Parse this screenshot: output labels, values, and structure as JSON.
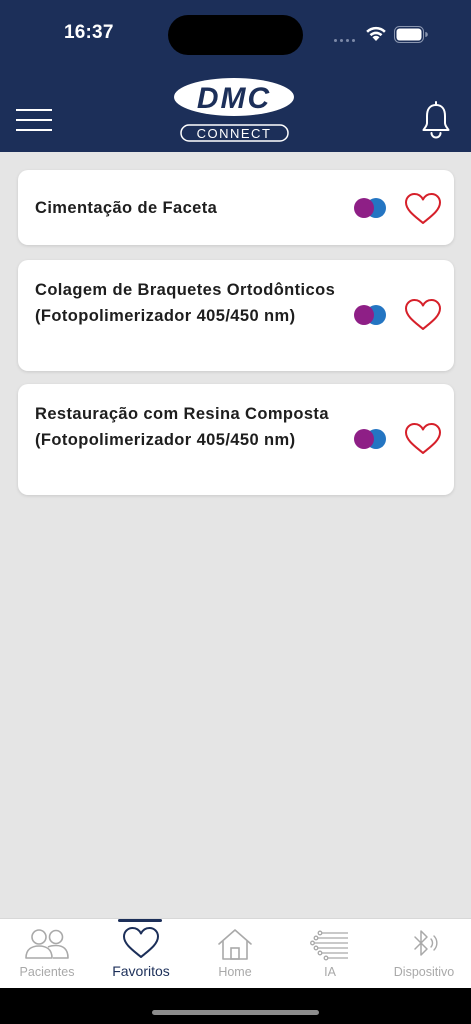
{
  "status_bar": {
    "time": "16:37"
  },
  "header": {
    "logo_top": "DMC",
    "logo_bottom": "CONNECT",
    "menu_icon": "hamburger-menu-icon",
    "notification_icon": "bell-icon"
  },
  "favorites": [
    {
      "title": "Cimentação de Faceta",
      "favorite": true
    },
    {
      "title": "Colagem de Braquetes Ortodônticos (Fotopolimerizador 405/450 nm)",
      "favorite": true
    },
    {
      "title": "Restauração com Resina Composta (Fotopolimerizador 405/450 nm)",
      "favorite": true
    }
  ],
  "tabs": [
    {
      "label": "Pacientes",
      "icon": "patients-icon",
      "active": false
    },
    {
      "label": "Favoritos",
      "icon": "heart-icon",
      "active": true
    },
    {
      "label": "Home",
      "icon": "home-icon",
      "active": false
    },
    {
      "label": "IA",
      "icon": "circuit-icon",
      "active": false
    },
    {
      "label": "Dispositivo",
      "icon": "bluetooth-icon",
      "active": false
    }
  ],
  "colors": {
    "header_bg": "#1c2f59",
    "heart": "#d6202a",
    "dot_purple": "#8e1f86",
    "dot_blue": "#2475c2",
    "tab_active": "#1c2f59",
    "tab_inactive": "#a9a9a9"
  }
}
